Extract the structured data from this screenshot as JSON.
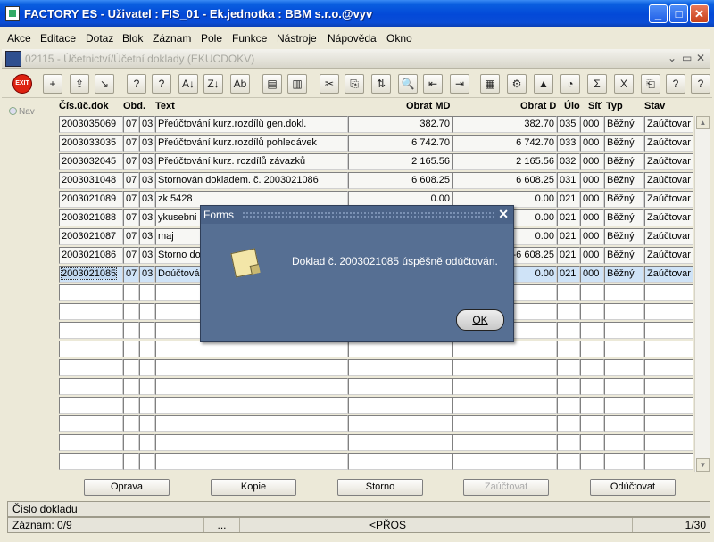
{
  "window": {
    "title": "FACTORY ES - Uživatel : FIS_01 - Ek.jednotka : BBM s.r.o.@vyv",
    "minimize": "_",
    "maximize": "□",
    "close": "✕"
  },
  "menu": [
    "Akce",
    "Editace",
    "Dotaz",
    "Blok",
    "Záznam",
    "Pole",
    "Funkce",
    "Nástroje",
    "Nápověda",
    "Okno"
  ],
  "form": {
    "title": "02115 - Účetnictví/Účetní doklady (EKUCDOKV)",
    "controls": [
      "⌄",
      "▭",
      "✕"
    ]
  },
  "toolbar": {
    "exit_label": "EXIT",
    "buttons": [
      "+",
      "⇪",
      "↘",
      "?",
      "?",
      "A↓",
      "Z↓",
      "Ab",
      "▤",
      "▥",
      "✂",
      "⎘",
      "⇅",
      "🔍",
      "⇤",
      "⇥",
      "▦",
      "⚙",
      "▲",
      "◔",
      "Σ",
      "X",
      "⎗",
      "?",
      "?"
    ]
  },
  "nav": {
    "label": "Nav"
  },
  "columns": [
    "Čís.úč.dok",
    "Obd.",
    "Text",
    "Obrat MD",
    "Obrat D",
    "Úlo",
    "Síť",
    "Typ",
    "Stav"
  ],
  "rows": [
    [
      "2003035069",
      "07",
      "03",
      "Přeúčtování kurz.rozdílů gen.dokl.",
      "382.70",
      "382.70",
      "035",
      "000",
      "Běžný",
      "Zaúčtovar"
    ],
    [
      "2003033035",
      "07",
      "03",
      "Přeúčtování kurz.rozdílů pohledávek",
      "6 742.70",
      "6 742.70",
      "033",
      "000",
      "Běžný",
      "Zaúčtovar"
    ],
    [
      "2003032045",
      "07",
      "03",
      "Přeúčtování kurz. rozdílů závazků",
      "2 165.56",
      "2 165.56",
      "032",
      "000",
      "Běžný",
      "Zaúčtovar"
    ],
    [
      "2003031048",
      "07",
      "03",
      "Stornován dokladem. č. 2003021086",
      "6 608.25",
      "6 608.25",
      "031",
      "000",
      "Běžný",
      "Zaúčtovar"
    ],
    [
      "2003021089",
      "07",
      "03",
      "zk 5428",
      "0.00",
      "0.00",
      "021",
      "000",
      "Běžný",
      "Zaúčtovar"
    ],
    [
      "2003021088",
      "07",
      "03",
      "ykusebni",
      "",
      "0.00",
      "021",
      "000",
      "Běžný",
      "Zaúčtovar"
    ],
    [
      "2003021087",
      "07",
      "03",
      "maj",
      "",
      "0.00",
      "021",
      "000",
      "Běžný",
      "Zaúčtovar"
    ],
    [
      "2003021086",
      "07",
      "03",
      "Storno do",
      "",
      "-6 608.25",
      "021",
      "000",
      "Běžný",
      "Zaúčtovar"
    ],
    [
      "2003021085",
      "07",
      "03",
      "Doúčtová",
      "",
      "0.00",
      "021",
      "000",
      "Běžný",
      "Zaúčtovar"
    ]
  ],
  "buttons": {
    "oprava": "Oprava",
    "kopie": "Kopie",
    "storno": "Storno",
    "zauctovat": "Zaúčtovat",
    "oductovat": "Odúčtovat"
  },
  "status": {
    "field": "Číslo dokladu",
    "record": "Záznam: 0/9",
    "mid": "...",
    "mode": "<PŘOS",
    "page": "1/30"
  },
  "dialog": {
    "title": "Forms",
    "message": "Doklad č. 2003021085 úspěšně odúčtován.",
    "ok": "OK",
    "close": "✕"
  },
  "colors": {
    "titlebar": "#0349d8",
    "dialog": "#566f93",
    "selected_row": "#cfe3f7"
  }
}
